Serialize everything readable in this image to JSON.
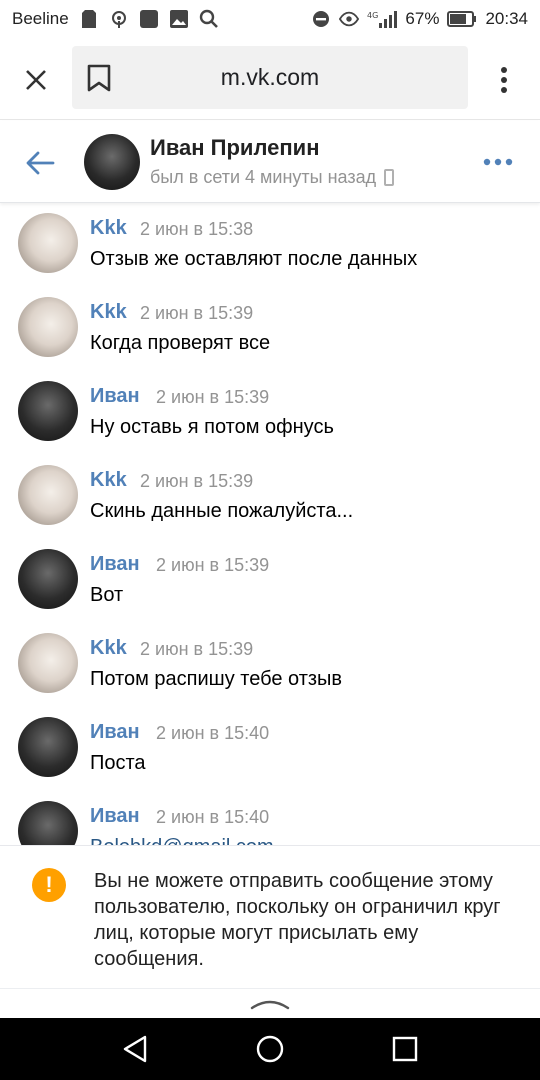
{
  "status_bar": {
    "carrier": "Beeline",
    "network_label": "4G",
    "battery": "67%",
    "time": "20:34"
  },
  "browser": {
    "url": "m.vk.com"
  },
  "chat": {
    "name": "Иван Прилепин",
    "status": "был в сети 4 минуты назад"
  },
  "messages": [
    {
      "author": "Kkk",
      "time": "2 июн в 15:38",
      "text": "Отзыв же оставляют после данных"
    },
    {
      "author": "Kkk",
      "time": "2 июн в 15:39",
      "text": "Когда проверят все"
    },
    {
      "author": "Иван",
      "time": "2 июн в 15:39",
      "text": "Ну оставь я потом офнусь"
    },
    {
      "author": "Kkk",
      "time": "2 июн в 15:39",
      "text": "Скинь данные пожалуйста..."
    },
    {
      "author": "Иван",
      "time": "2 июн в 15:39",
      "text": "Вот"
    },
    {
      "author": "Kkk",
      "time": "2 июн в 15:39",
      "text": "Потом распишу тебе отзыв"
    },
    {
      "author": "Иван",
      "time": "2 июн в 15:40",
      "text": "Поста"
    },
    {
      "author": "Иван",
      "time": "2 июн в 15:40",
      "text": "Bolobkd@gmail.com"
    }
  ],
  "notice": {
    "text": "Вы не можете отправить сообщение этому пользователю, поскольку он ограничил круг лиц, которые могут присылать ему сообщения."
  },
  "colors": {
    "accent": "#5181b8",
    "warning": "#ffa000"
  }
}
